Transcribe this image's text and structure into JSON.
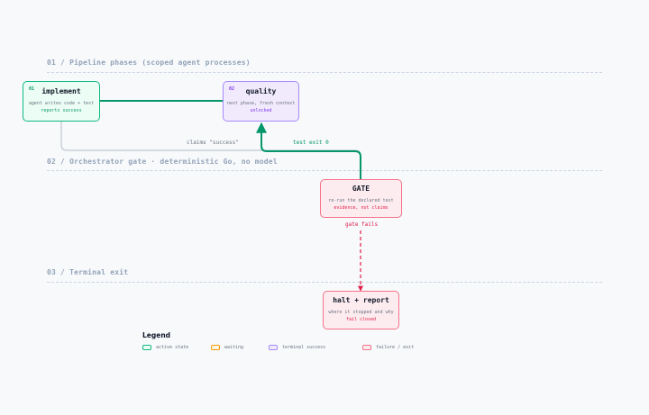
{
  "sections": [
    {
      "label": "01 / Pipeline phases (scoped agent processes)"
    },
    {
      "label": "02 / Orchestrator gate · deterministic Go, no model"
    },
    {
      "label": "03 / Terminal exit"
    }
  ],
  "nodes": {
    "implement": {
      "num": "01",
      "title": "implement",
      "sub": "agent writes code + test",
      "accent": "reports success"
    },
    "quality": {
      "num": "02",
      "title": "quality",
      "sub": "next phase, fresh context",
      "accent": "unlocked"
    },
    "gate": {
      "title": "GATE",
      "sub": "re-run the declared test",
      "accent": "evidence, not claims"
    },
    "halt": {
      "title": "halt + report",
      "sub": "where it stopped and why",
      "accent": "fail closed"
    }
  },
  "edges": {
    "claims": "claims \"success\"",
    "test_exit": "test exit 0",
    "gate_fails": "gate fails"
  },
  "legend": {
    "title": "Legend",
    "items": [
      {
        "label": "active state",
        "fill": "#ecfdf5",
        "stroke": "#10b981"
      },
      {
        "label": "waiting",
        "fill": "#fdf6e3",
        "stroke": "#f59e0b"
      },
      {
        "label": "terminal success",
        "fill": "#f1eafd",
        "stroke": "#a78bfa"
      },
      {
        "label": "failure / exit",
        "fill": "#fdecef",
        "stroke": "#f87189"
      }
    ]
  },
  "colors": {
    "success_edge": "#059669",
    "neutral_edge": "#b6bec9",
    "fail_edge": "#e11d48"
  }
}
